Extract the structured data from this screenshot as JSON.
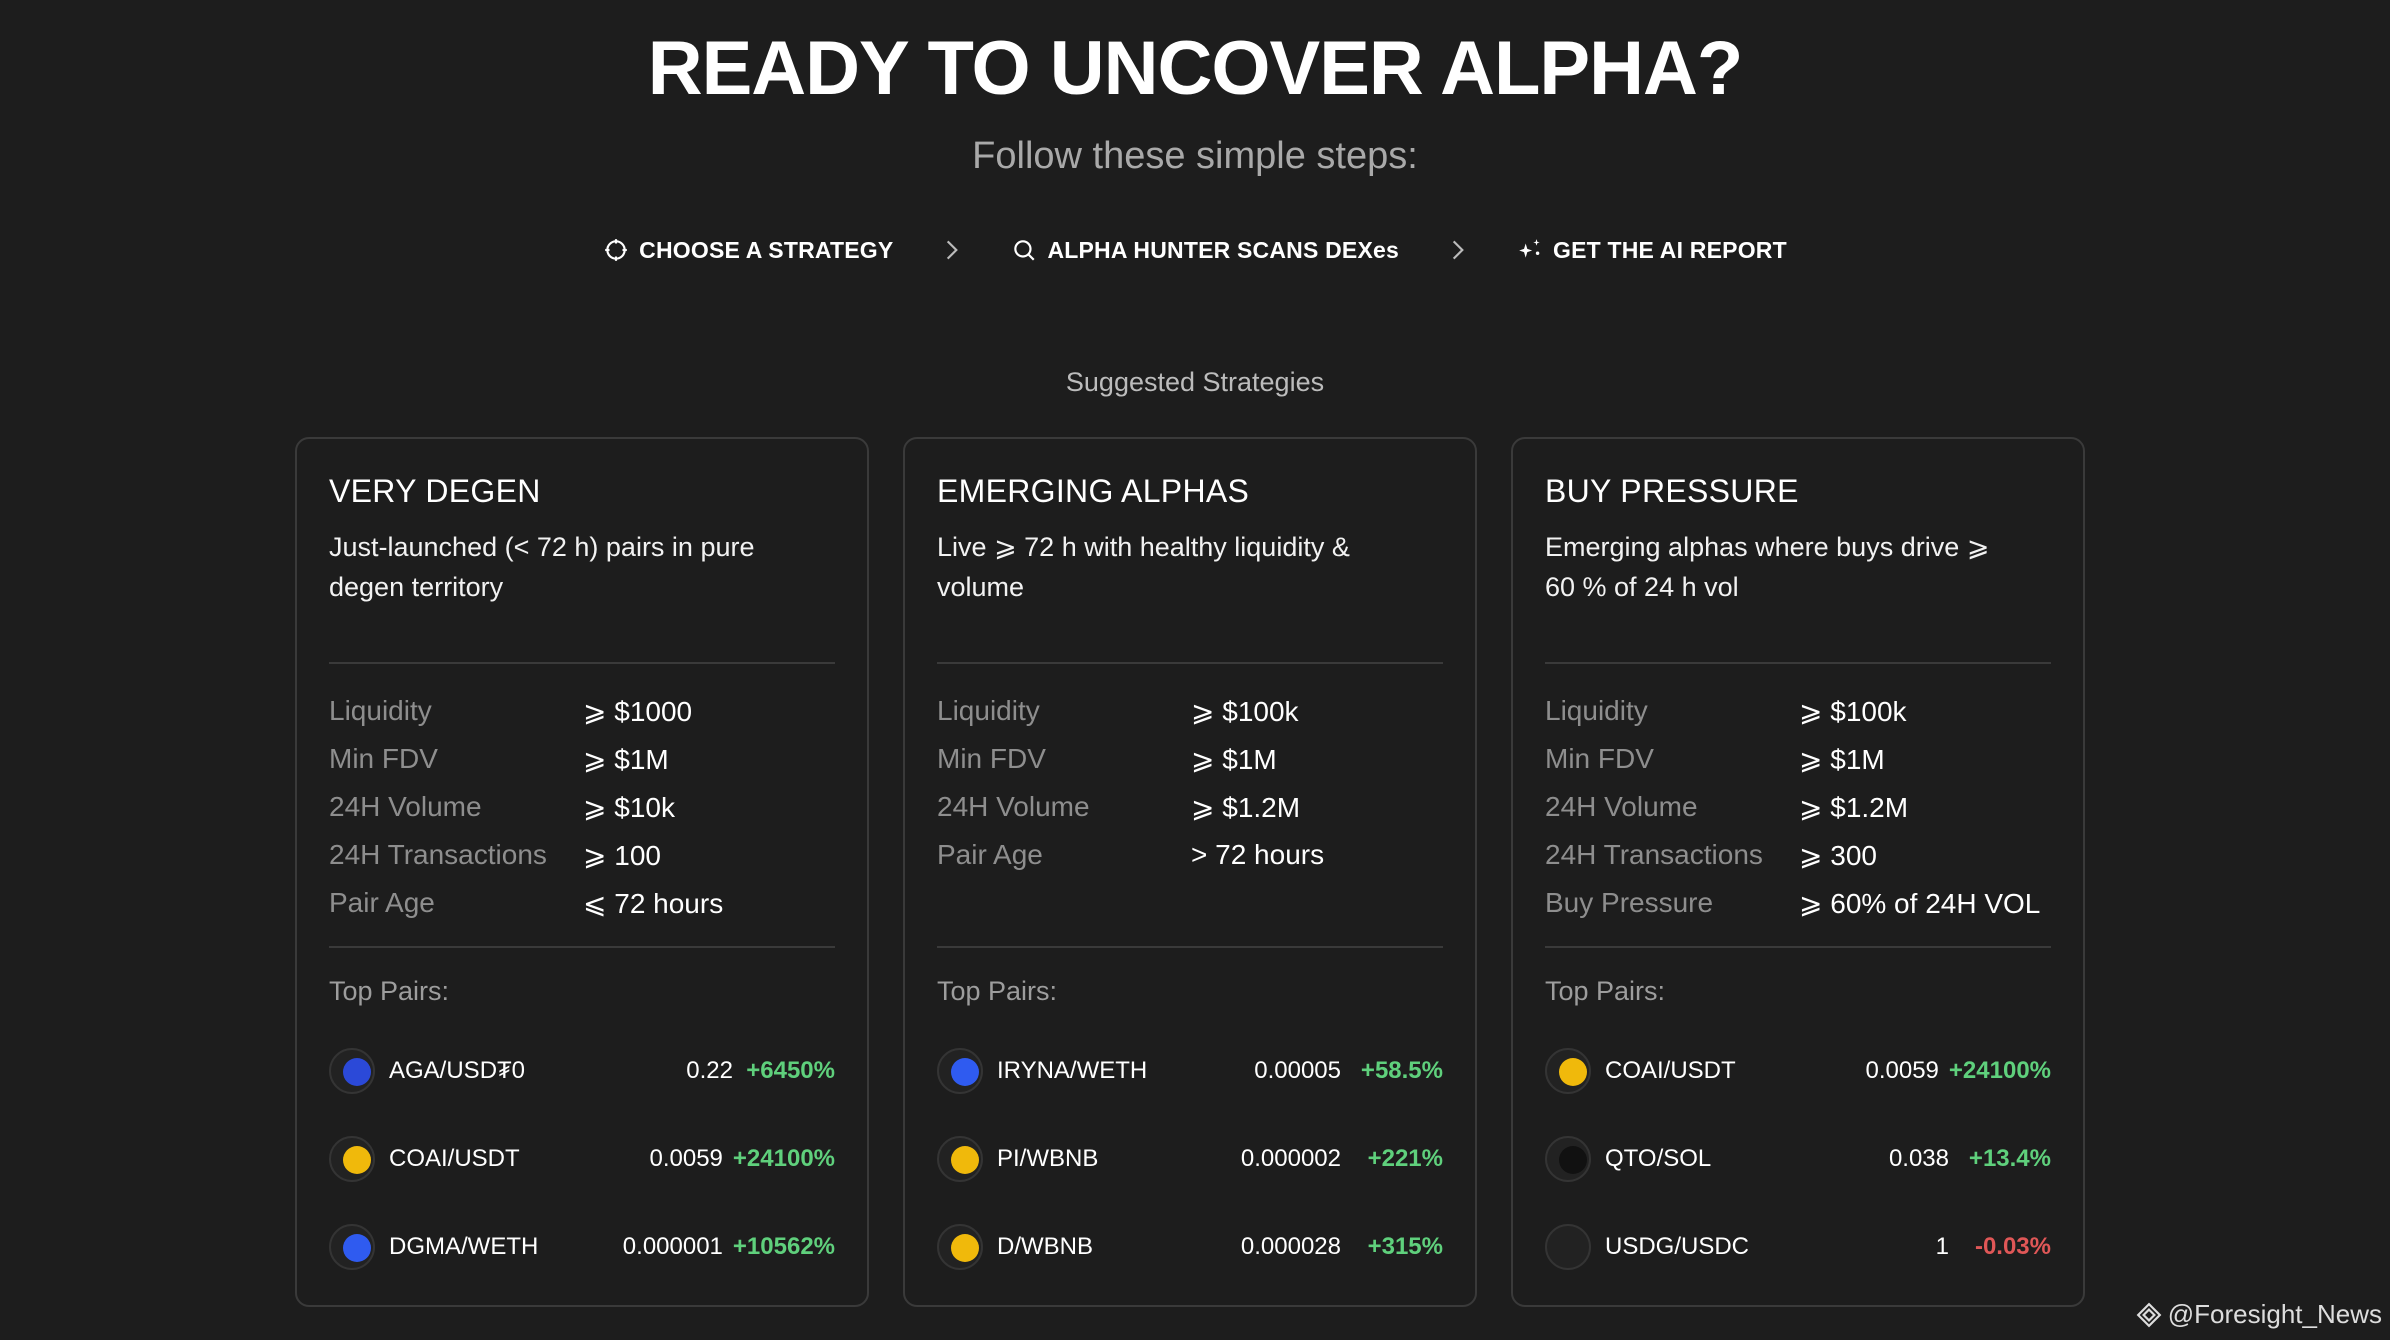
{
  "header": {
    "title": "READY TO UNCOVER ALPHA?",
    "subtitle": "Follow these simple steps:"
  },
  "steps": [
    {
      "label": "CHOOSE A STRATEGY",
      "icon": "strategy-icon"
    },
    {
      "label": "ALPHA HUNTER SCANS DEXes",
      "icon": "search-icon"
    },
    {
      "label": "GET THE AI REPORT",
      "icon": "sparkle-icon"
    }
  ],
  "section_label": "Suggested Strategies",
  "cards": [
    {
      "title": "VERY DEGEN",
      "description": "Just-launched (< 72 h) pairs in pure degen territory",
      "criteria": [
        {
          "label": "Liquidity",
          "value": "⩾ $1000"
        },
        {
          "label": "Min FDV",
          "value": "⩾ $1M"
        },
        {
          "label": "24H Volume",
          "value": "⩾ $10k"
        },
        {
          "label": "24H Transactions",
          "value": "⩾ 100"
        },
        {
          "label": "Pair Age",
          "value": "⩽ 72 hours"
        }
      ],
      "top_pairs_label": "Top Pairs:",
      "pairs": [
        {
          "name": "AGA/USD₮0",
          "price": "0.22",
          "change": "+6450%",
          "icon_color": "#2b49d8",
          "icon": "aga-token-icon"
        },
        {
          "name": "COAI/USDT",
          "price": "0.0059",
          "change": "+24100%",
          "icon_color": "#f0b90b",
          "icon": "bnb-token-icon"
        },
        {
          "name": "DGMA/WETH",
          "price": "0.000001",
          "change": "+10562%",
          "icon_color": "#2f5bf0",
          "icon": "base-token-icon"
        }
      ]
    },
    {
      "title": "EMERGING ALPHAS",
      "description": "Live ⩾ 72 h with healthy liquidity & volume",
      "criteria": [
        {
          "label": "Liquidity",
          "value": "⩾ $100k"
        },
        {
          "label": "Min FDV",
          "value": "⩾ $1M"
        },
        {
          "label": "24H Volume",
          "value": "⩾ $1.2M"
        },
        {
          "label": "Pair Age",
          "value": "> 72 hours"
        }
      ],
      "top_pairs_label": "Top Pairs:",
      "pairs": [
        {
          "name": "IRYNA/WETH",
          "price": "0.00005",
          "change": "+58.5%",
          "icon_color": "#2f5bf0",
          "icon": "base-token-icon"
        },
        {
          "name": "PI/WBNB",
          "price": "0.000002",
          "change": "+221%",
          "icon_color": "#f0b90b",
          "icon": "bnb-token-icon"
        },
        {
          "name": "D/WBNB",
          "price": "0.000028",
          "change": "+315%",
          "icon_color": "#f0b90b",
          "icon": "bnb-token-icon"
        }
      ]
    },
    {
      "title": "BUY PRESSURE",
      "description": "Emerging alphas where buys drive ⩾ 60 % of 24 h vol",
      "criteria": [
        {
          "label": "Liquidity",
          "value": "⩾ $100k"
        },
        {
          "label": "Min FDV",
          "value": "⩾ $1M"
        },
        {
          "label": "24H Volume",
          "value": "⩾ $1.2M"
        },
        {
          "label": "24H Transactions",
          "value": "⩾ 300"
        },
        {
          "label": "Buy Pressure",
          "value": "⩾ 60% of 24H VOL"
        }
      ],
      "top_pairs_label": "Top Pairs:",
      "pairs": [
        {
          "name": "COAI/USDT",
          "price": "0.0059",
          "change": "+24100%",
          "icon_color": "#f0b90b",
          "icon": "bnb-token-icon"
        },
        {
          "name": "QTO/SOL",
          "price": "0.038",
          "change": "+13.4%",
          "icon_color": "#111111",
          "icon": "qto-token-icon"
        },
        {
          "name": "USDG/USDC",
          "price": "1",
          "change": "-0.03%",
          "icon_color": "#222222",
          "icon": "solana-token-icon"
        }
      ]
    }
  ],
  "watermark": "@Foresight_News",
  "colors": {
    "background": "#1d1d1d",
    "positive": "#5fd07c",
    "negative": "#e05757",
    "border": "#3a3a3a"
  }
}
